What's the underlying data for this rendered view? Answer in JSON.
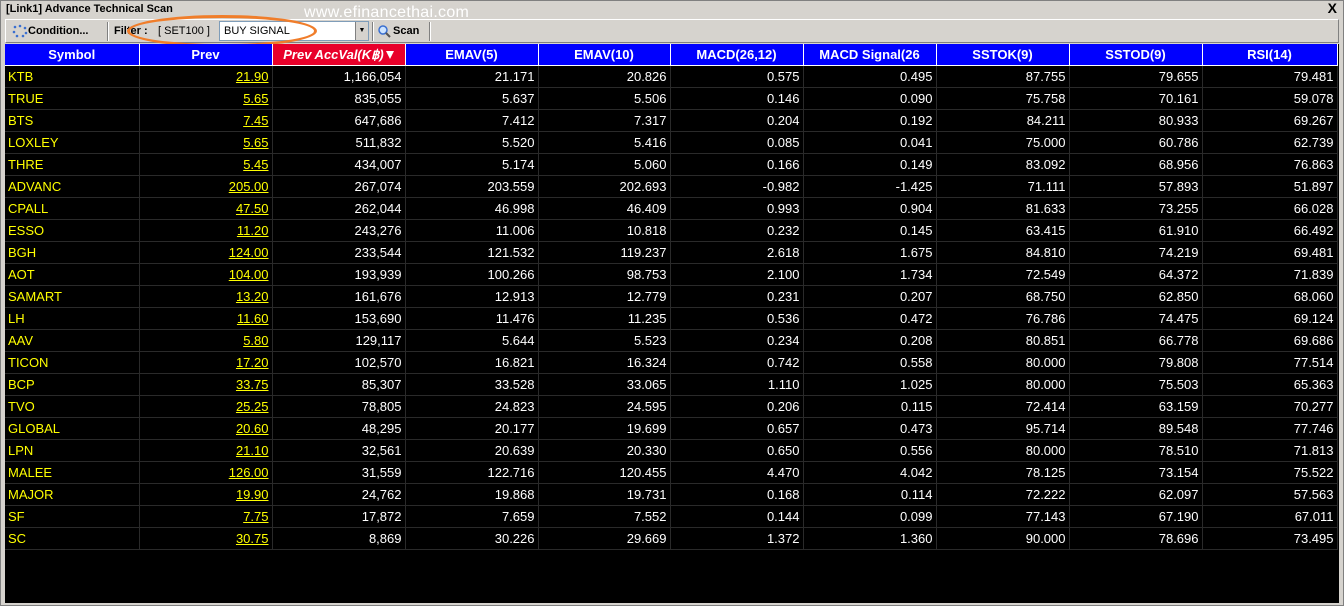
{
  "window": {
    "title": "[Link1] Advance Technical Scan",
    "close": "X"
  },
  "watermark": "www.efinancethai.com",
  "toolbar": {
    "condition_label": "Condition...",
    "filter_label": "Filter :",
    "filter_set": "[ SET100 ]",
    "filter_value": "BUY SIGNAL",
    "scan_label": "Scan"
  },
  "table": {
    "headers": [
      "Symbol",
      "Prev",
      "Prev AccVal(K฿)",
      "EMAV(5)",
      "EMAV(10)",
      "MACD(26,12)",
      "MACD Signal(26",
      "SSTOK(9)",
      "SSTOD(9)",
      "RSI(14)"
    ],
    "rows": [
      [
        "KTB",
        "21.90",
        "1,166,054",
        "21.171",
        "20.826",
        "0.575",
        "0.495",
        "87.755",
        "79.655",
        "79.481"
      ],
      [
        "TRUE",
        "5.65",
        "835,055",
        "5.637",
        "5.506",
        "0.146",
        "0.090",
        "75.758",
        "70.161",
        "59.078"
      ],
      [
        "BTS",
        "7.45",
        "647,686",
        "7.412",
        "7.317",
        "0.204",
        "0.192",
        "84.211",
        "80.933",
        "69.267"
      ],
      [
        "LOXLEY",
        "5.65",
        "511,832",
        "5.520",
        "5.416",
        "0.085",
        "0.041",
        "75.000",
        "60.786",
        "62.739"
      ],
      [
        "THRE",
        "5.45",
        "434,007",
        "5.174",
        "5.060",
        "0.166",
        "0.149",
        "83.092",
        "68.956",
        "76.863"
      ],
      [
        "ADVANC",
        "205.00",
        "267,074",
        "203.559",
        "202.693",
        "-0.982",
        "-1.425",
        "71.111",
        "57.893",
        "51.897"
      ],
      [
        "CPALL",
        "47.50",
        "262,044",
        "46.998",
        "46.409",
        "0.993",
        "0.904",
        "81.633",
        "73.255",
        "66.028"
      ],
      [
        "ESSO",
        "11.20",
        "243,276",
        "11.006",
        "10.818",
        "0.232",
        "0.145",
        "63.415",
        "61.910",
        "66.492"
      ],
      [
        "BGH",
        "124.00",
        "233,544",
        "121.532",
        "119.237",
        "2.618",
        "1.675",
        "84.810",
        "74.219",
        "69.481"
      ],
      [
        "AOT",
        "104.00",
        "193,939",
        "100.266",
        "98.753",
        "2.100",
        "1.734",
        "72.549",
        "64.372",
        "71.839"
      ],
      [
        "SAMART",
        "13.20",
        "161,676",
        "12.913",
        "12.779",
        "0.231",
        "0.207",
        "68.750",
        "62.850",
        "68.060"
      ],
      [
        "LH",
        "11.60",
        "153,690",
        "11.476",
        "11.235",
        "0.536",
        "0.472",
        "76.786",
        "74.475",
        "69.124"
      ],
      [
        "AAV",
        "5.80",
        "129,117",
        "5.644",
        "5.523",
        "0.234",
        "0.208",
        "80.851",
        "66.778",
        "69.686"
      ],
      [
        "TICON",
        "17.20",
        "102,570",
        "16.821",
        "16.324",
        "0.742",
        "0.558",
        "80.000",
        "79.808",
        "77.514"
      ],
      [
        "BCP",
        "33.75",
        "85,307",
        "33.528",
        "33.065",
        "1.110",
        "1.025",
        "80.000",
        "75.503",
        "65.363"
      ],
      [
        "TVO",
        "25.25",
        "78,805",
        "24.823",
        "24.595",
        "0.206",
        "0.115",
        "72.414",
        "63.159",
        "70.277"
      ],
      [
        "GLOBAL",
        "20.60",
        "48,295",
        "20.177",
        "19.699",
        "0.657",
        "0.473",
        "95.714",
        "89.548",
        "77.746"
      ],
      [
        "LPN",
        "21.10",
        "32,561",
        "20.639",
        "20.330",
        "0.650",
        "0.556",
        "80.000",
        "78.510",
        "71.813"
      ],
      [
        "MALEE",
        "126.00",
        "31,559",
        "122.716",
        "120.455",
        "4.470",
        "4.042",
        "78.125",
        "73.154",
        "75.522"
      ],
      [
        "MAJOR",
        "19.90",
        "24,762",
        "19.868",
        "19.731",
        "0.168",
        "0.114",
        "72.222",
        "62.097",
        "57.563"
      ],
      [
        "SF",
        "7.75",
        "17,872",
        "7.659",
        "7.552",
        "0.144",
        "0.099",
        "77.143",
        "67.190",
        "67.011"
      ],
      [
        "SC",
        "30.75",
        "8,869",
        "30.226",
        "29.669",
        "1.372",
        "1.360",
        "90.000",
        "78.696",
        "73.495"
      ]
    ]
  },
  "icons": {
    "condition": "settings-dots-icon",
    "scan": "magnifier-icon",
    "sort": "sort-desc-icon"
  },
  "colors": {
    "header_bg": "#0000ff",
    "sorted_header_bg": "#e8002a",
    "symbol_text": "#ffff00",
    "grid_bg": "#000000",
    "highlight_oval": "#f07d2a"
  }
}
